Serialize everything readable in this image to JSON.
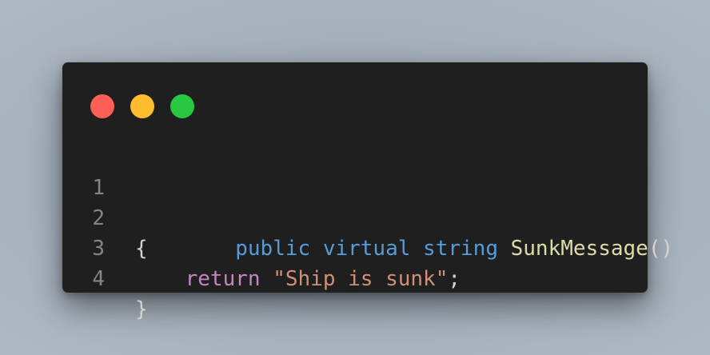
{
  "window": {
    "controls": [
      {
        "name": "close-dot",
        "color": "#ff5f57"
      },
      {
        "name": "minimize-dot",
        "color": "#febc2e"
      },
      {
        "name": "maximize-dot",
        "color": "#28c840"
      }
    ]
  },
  "colors": {
    "keyword": "#569cd6",
    "function": "#dcdcaa",
    "control": "#c586c0",
    "string": "#ce9178",
    "punctuation": "#d4d4d4",
    "line_number": "#858585",
    "background": "#1f1f1f"
  },
  "code": {
    "lines": [
      {
        "number": "1",
        "tokens": [
          {
            "text": "public",
            "type": "keyword"
          },
          {
            "text": " ",
            "type": "punctuation"
          },
          {
            "text": "virtual",
            "type": "keyword"
          },
          {
            "text": " ",
            "type": "punctuation"
          },
          {
            "text": "string",
            "type": "keyword"
          },
          {
            "text": " ",
            "type": "punctuation"
          },
          {
            "text": "SunkMessage",
            "type": "function"
          },
          {
            "text": "()",
            "type": "punctuation"
          }
        ]
      },
      {
        "number": "2",
        "tokens": [
          {
            "text": "{",
            "type": "punctuation"
          }
        ]
      },
      {
        "number": "3",
        "tokens": [
          {
            "text": "    ",
            "type": "punctuation"
          },
          {
            "text": "return",
            "type": "control"
          },
          {
            "text": " ",
            "type": "punctuation"
          },
          {
            "text": "\"Ship is sunk\"",
            "type": "string"
          },
          {
            "text": ";",
            "type": "punctuation"
          }
        ]
      },
      {
        "number": "4",
        "tokens": [
          {
            "text": "}",
            "type": "punctuation"
          }
        ]
      }
    ]
  }
}
